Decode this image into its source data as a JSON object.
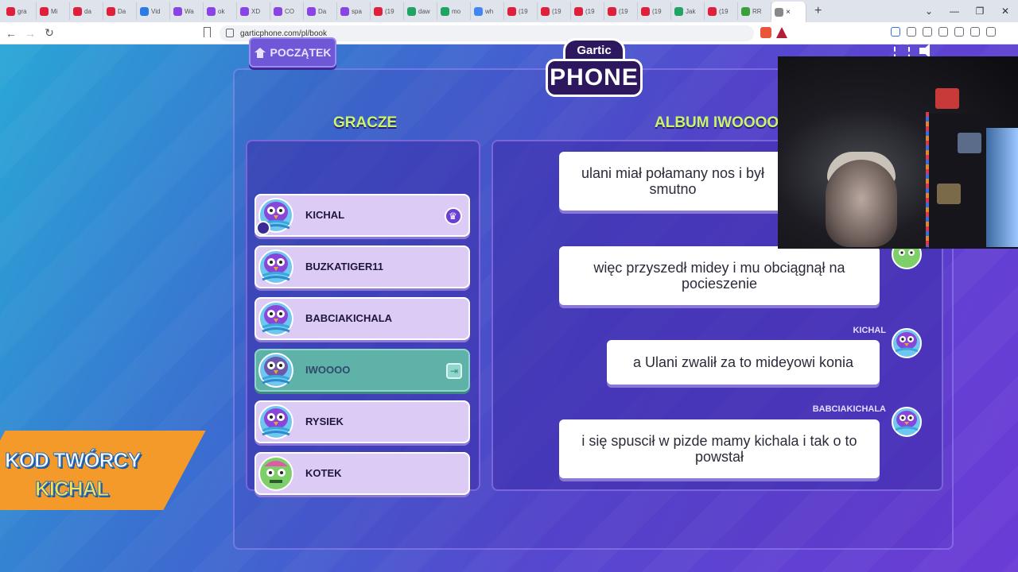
{
  "browser": {
    "tabs": [
      {
        "label": "gra",
        "color": "#e0203a"
      },
      {
        "label": "Mi",
        "color": "#e0203a"
      },
      {
        "label": "da",
        "color": "#e0203a"
      },
      {
        "label": "Da",
        "color": "#e0203a"
      },
      {
        "label": "Vid",
        "color": "#2a7be4"
      },
      {
        "label": "Wa",
        "color": "#8a44e6"
      },
      {
        "label": "ok",
        "color": "#8a44e6"
      },
      {
        "label": "XD",
        "color": "#8a44e6"
      },
      {
        "label": "CO",
        "color": "#8a44e6"
      },
      {
        "label": "Da",
        "color": "#8a44e6"
      },
      {
        "label": "spa",
        "color": "#8a44e6"
      },
      {
        "label": "(19",
        "color": "#e0203a"
      },
      {
        "label": "daw",
        "color": "#1fa463"
      },
      {
        "label": "mo",
        "color": "#1fa463"
      },
      {
        "label": "wh",
        "color": "#4285f4"
      },
      {
        "label": "(19",
        "color": "#e0203a"
      },
      {
        "label": "(19",
        "color": "#e0203a"
      },
      {
        "label": "(19",
        "color": "#e0203a"
      },
      {
        "label": "(19",
        "color": "#e0203a"
      },
      {
        "label": "(19",
        "color": "#e0203a"
      },
      {
        "label": "Jak",
        "color": "#1fa463"
      },
      {
        "label": "(19",
        "color": "#e0203a"
      },
      {
        "label": "RR",
        "color": "#3aa13a"
      }
    ],
    "active_tab": {
      "label": "",
      "close": "×"
    },
    "new_tab": "+",
    "window_controls": [
      "⌄",
      "—",
      "❐",
      "✕"
    ],
    "nav": {
      "back": "←",
      "forward": "→",
      "reload": "↻"
    },
    "url": "garticphone.com/pl/book",
    "ext_colors": [
      "#e8553a",
      "#b21f3a"
    ]
  },
  "game": {
    "home_label": "POCZĄTEK",
    "logo_top": "Gartic",
    "logo_bottom": "PHONE",
    "players_title": "GRACZE",
    "album_title": "ALBUM IWOOOO",
    "players": [
      {
        "name": "KICHAL",
        "avatar": "purple-bird",
        "host": true,
        "dim": false
      },
      {
        "name": "BUZKATIGER11",
        "avatar": "purple-bird",
        "host": false,
        "dim": false
      },
      {
        "name": "BABCIAKICHALA",
        "avatar": "purple-bird",
        "host": false,
        "dim": false
      },
      {
        "name": "IWOOOO",
        "avatar": "purple-bird",
        "host": false,
        "dim": true
      },
      {
        "name": "RYSIEK",
        "avatar": "purple-bird",
        "host": false,
        "dim": false
      },
      {
        "name": "KOTEK",
        "avatar": "green-zombie",
        "host": false,
        "dim": false
      }
    ],
    "album_entries": [
      {
        "text": "ulani miał połamany nos i był smutno",
        "author": ""
      },
      {
        "text": "więc przyszedł midey i mu obciągnął na pocieszenie",
        "author": ""
      },
      {
        "text": "a Ulani zwalił za to mideyowi konia",
        "author": "KICHAL"
      },
      {
        "text": "i się spuscił w pizde mamy kichala i tak o to powstał",
        "author": "BABCIAKICHALA"
      }
    ]
  },
  "overlay": {
    "creator_line1": "KOD TWÓRCY",
    "creator_line2": "KICHAL"
  }
}
